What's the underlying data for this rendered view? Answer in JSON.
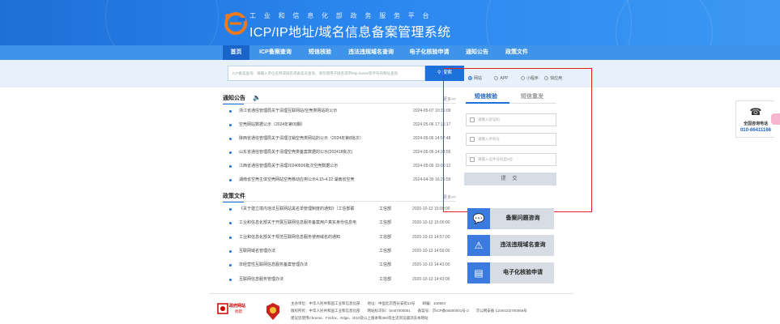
{
  "header": {
    "subtitle": "工业和信息化部政务服务平台",
    "title": "ICP/IP地址/域名信息备案管理系统"
  },
  "nav": {
    "items": [
      {
        "label": "首页",
        "active": true
      },
      {
        "label": "ICP备案查询",
        "active": false
      },
      {
        "label": "短信核验",
        "active": false
      },
      {
        "label": "违法违规域名查询",
        "active": false
      },
      {
        "label": "电子化核验申请",
        "active": false
      },
      {
        "label": "通知公告",
        "active": false
      },
      {
        "label": "政策文件",
        "active": false
      }
    ]
  },
  "search": {
    "placeholder": "ICP备案查询：请输入单位名称或域名或备案号查询，请勿使用子域名或带http://www等字符的网址查询",
    "button_label": "搜索",
    "options": [
      {
        "label": "网站",
        "selected": true
      },
      {
        "label": "APP",
        "selected": false
      },
      {
        "label": "小程序",
        "selected": false
      },
      {
        "label": "快应用",
        "selected": false
      }
    ]
  },
  "notices": {
    "title": "通知公告",
    "more": "更多>>",
    "items": [
      {
        "title": "浙江省通信管理局关于清理互联网站/空壳类网站的公示",
        "date": "2024-05-07 10:36:09"
      },
      {
        "title": "空壳网站数据公示（2024年第09期）",
        "date": "2024-05-06 17:16:17"
      },
      {
        "title": "陕西省通信管理局关于清理注销空壳类网站的公示（2024年第8批次）",
        "date": "2024-05-06 14:57:48"
      },
      {
        "title": "山东省通信管理局关于清理空壳类备案数据的公示(202418批次)",
        "date": "2024-05-06 14:33:55"
      },
      {
        "title": "江西省通信管理局关于清理20240506批次空壳数据公示",
        "date": "2024-05-06 10:06:12"
      },
      {
        "title": "湖南省空壳主体空壳网站空壳移动应用公示4.15-4.22 湖南省空壳",
        "date": "2024-04-30 16:26:59"
      }
    ]
  },
  "policies": {
    "title": "政策文件",
    "more": "更多>>",
    "items": [
      {
        "title": "《关于建立境内违法互联网站黑名单管理制度的通知》（工信部联",
        "org": "工信部",
        "date": "2020-10-13 15:00:00"
      },
      {
        "title": "工业和信息化部关于开展互联网信息服务备案用户真实身份信息电",
        "org": "工信部",
        "date": "2020-10-13 15:00:00"
      },
      {
        "title": "工业和信息化部关于规范互联网信息服务使用域名的通知",
        "org": "工信部",
        "date": "2020-10-13 14:57:00"
      },
      {
        "title": "互联网域名管理办法",
        "org": "工信部",
        "date": "2020-10-13 14:56:00"
      },
      {
        "title": "非经营性互联网信息服务备案管理办法",
        "org": "工信部",
        "date": "2020-10-13 14:43:00"
      },
      {
        "title": "互联网信息服务管理办法",
        "org": "工信部",
        "date": "2020-10-13 14:43:00"
      }
    ]
  },
  "verify_panel": {
    "tabs": [
      {
        "label": "短信核验",
        "active": true
      },
      {
        "label": "短信重发",
        "active": false
      }
    ],
    "fields": [
      {
        "placeholder": "请输入验证码",
        "icon": "key-icon"
      },
      {
        "placeholder": "请输入手机号",
        "icon": "phone-icon"
      },
      {
        "placeholder": "请输入证件号码后6位",
        "icon": "id-card-icon"
      }
    ],
    "submit_label": "提 交"
  },
  "quick_links": [
    {
      "label": "备案问题咨询",
      "icon": "consult-icon"
    },
    {
      "label": "违法违规域名查询",
      "icon": "warning-icon"
    },
    {
      "label": "电子化核验申请",
      "icon": "form-icon"
    }
  ],
  "hotline": {
    "label": "全国咨询电话",
    "number": "010-66411166",
    "icon": "telephone-icon"
  },
  "footer": {
    "gov_logo_text": "政府网站",
    "gov_logo_sub": "找错",
    "lines": [
      "主办单位：中华人民共和国工业和信息化部　　地址：中国北京西长安街13号　　邮编：100804",
      "版权所有：中华人民共和国工业和信息化部　　网站标识码：bm07000001　　备案号：京ICP备04000001号-2　　京公网安备 11040102700068号",
      "建议您使用Chrome、Firefox、Edge、IE10及以上版本和360等主流浏览器浏览本网站"
    ]
  },
  "colors": {
    "header_blue": "#2a86ee",
    "nav_blue": "#3f94ea",
    "accent": "#1d72d9",
    "highlight_red": "#e02424"
  }
}
